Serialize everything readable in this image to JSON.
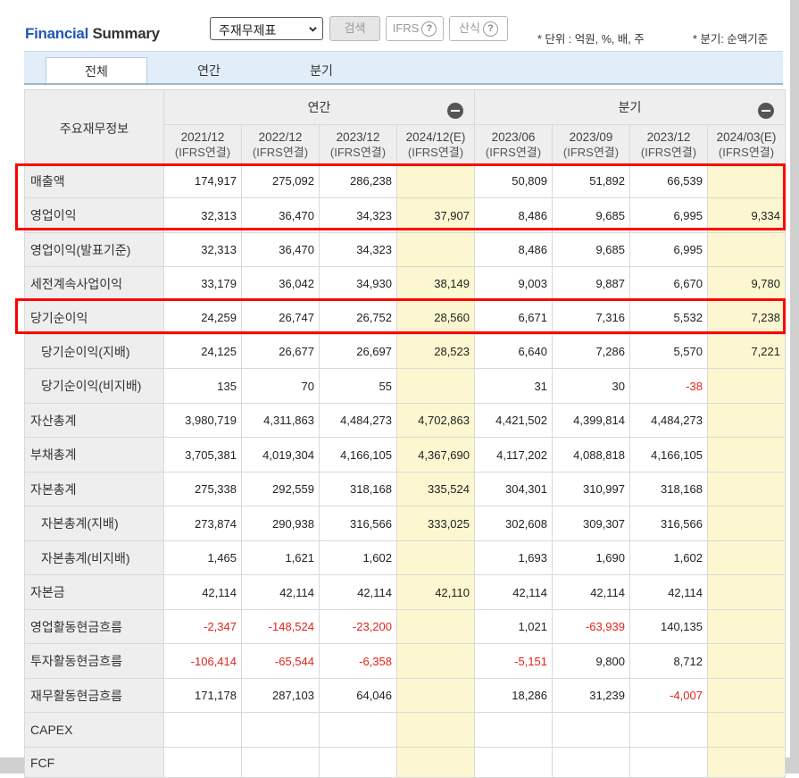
{
  "title": {
    "part1": "Financial",
    "part2": "Summary"
  },
  "toolbar": {
    "select_value": "주재무제표",
    "search_label": "검색",
    "ifrs_label": "IFRS",
    "formula_label": "산식",
    "help_glyph": "?"
  },
  "notes": {
    "unit": "* 단위 : 억원, %, 배, 주",
    "quarter": "* 분기: 순액기준"
  },
  "tabs": [
    {
      "label": "전체",
      "active": true
    },
    {
      "label": "연간",
      "active": false
    },
    {
      "label": "분기",
      "active": false
    }
  ],
  "table": {
    "corner_label": "주요재무정보",
    "groups": {
      "annual": "연간",
      "quarter": "분기"
    },
    "columns": [
      {
        "period": "2021/12",
        "sub": "(IFRS연결)"
      },
      {
        "period": "2022/12",
        "sub": "(IFRS연결)"
      },
      {
        "period": "2023/12",
        "sub": "(IFRS연결)"
      },
      {
        "period": "2024/12(E)",
        "sub": "(IFRS연결)"
      },
      {
        "period": "2023/06",
        "sub": "(IFRS연결)"
      },
      {
        "period": "2023/09",
        "sub": "(IFRS연결)"
      },
      {
        "period": "2023/12",
        "sub": "(IFRS연결)"
      },
      {
        "period": "2024/03(E)",
        "sub": "(IFRS연결)"
      }
    ],
    "rows": [
      {
        "label": "매출액",
        "values": [
          "174,917",
          "275,092",
          "286,238",
          "",
          "50,809",
          "51,892",
          "66,539",
          ""
        ]
      },
      {
        "label": "영업이익",
        "values": [
          "32,313",
          "36,470",
          "34,323",
          "37,907",
          "8,486",
          "9,685",
          "6,995",
          "9,334"
        ]
      },
      {
        "label": "영업이익(발표기준)",
        "values": [
          "32,313",
          "36,470",
          "34,323",
          "",
          "8,486",
          "9,685",
          "6,995",
          ""
        ]
      },
      {
        "label": "세전계속사업이익",
        "values": [
          "33,179",
          "36,042",
          "34,930",
          "38,149",
          "9,003",
          "9,887",
          "6,670",
          "9,780"
        ]
      },
      {
        "label": "당기순이익",
        "values": [
          "24,259",
          "26,747",
          "26,752",
          "28,560",
          "6,671",
          "7,316",
          "5,532",
          "7,238"
        ]
      },
      {
        "label": "당기순이익(지배)",
        "values": [
          "24,125",
          "26,677",
          "26,697",
          "28,523",
          "6,640",
          "7,286",
          "5,570",
          "7,221"
        ]
      },
      {
        "label": "당기순이익(비지배)",
        "values": [
          "135",
          "70",
          "55",
          "",
          "31",
          "30",
          "-38",
          ""
        ]
      },
      {
        "label": "자산총계",
        "values": [
          "3,980,719",
          "4,311,863",
          "4,484,273",
          "4,702,863",
          "4,421,502",
          "4,399,814",
          "4,484,273",
          ""
        ]
      },
      {
        "label": "부채총계",
        "values": [
          "3,705,381",
          "4,019,304",
          "4,166,105",
          "4,367,690",
          "4,117,202",
          "4,088,818",
          "4,166,105",
          ""
        ]
      },
      {
        "label": "자본총계",
        "values": [
          "275,338",
          "292,559",
          "318,168",
          "335,524",
          "304,301",
          "310,997",
          "318,168",
          ""
        ]
      },
      {
        "label": "자본총계(지배)",
        "values": [
          "273,874",
          "290,938",
          "316,566",
          "333,025",
          "302,608",
          "309,307",
          "316,566",
          ""
        ]
      },
      {
        "label": "자본총계(비지배)",
        "values": [
          "1,465",
          "1,621",
          "1,602",
          "",
          "1,693",
          "1,690",
          "1,602",
          ""
        ]
      },
      {
        "label": "자본금",
        "values": [
          "42,114",
          "42,114",
          "42,114",
          "42,110",
          "42,114",
          "42,114",
          "42,114",
          ""
        ]
      },
      {
        "label": "영업활동현금흐름",
        "values": [
          "-2,347",
          "-148,524",
          "-23,200",
          "",
          "1,021",
          "-63,939",
          "140,135",
          ""
        ]
      },
      {
        "label": "투자활동현금흐름",
        "values": [
          "-106,414",
          "-65,544",
          "-6,358",
          "",
          "-5,151",
          "9,800",
          "8,712",
          ""
        ]
      },
      {
        "label": "재무활동현금흐름",
        "values": [
          "171,178",
          "287,103",
          "64,046",
          "",
          "18,286",
          "31,239",
          "-4,007",
          ""
        ]
      },
      {
        "label": "CAPEX",
        "values": [
          "",
          "",
          "",
          "",
          "",
          "",
          "",
          ""
        ]
      },
      {
        "label": "FCF",
        "values": [
          "",
          "",
          "",
          "",
          "",
          "",
          "",
          ""
        ]
      }
    ]
  },
  "colors": {
    "highlight": "#ff0000",
    "estimate_bg": "#fcf7d0",
    "negative": "#e0231b",
    "brand_blue": "#1f57b7"
  }
}
